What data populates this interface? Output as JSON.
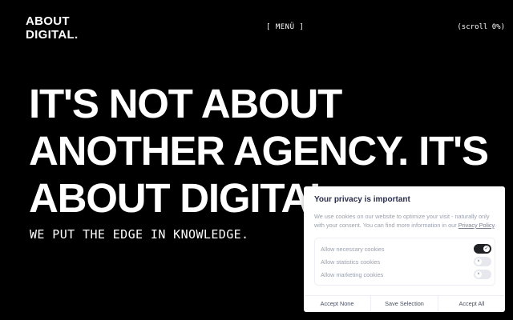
{
  "header": {
    "logo_line1": "ABOUT",
    "logo_line2": "DIGITAL.",
    "menu_label": "[ MENÜ ]",
    "scroll_label": "(scroll 0%)"
  },
  "hero": {
    "line1": "IT'S NOT ABOUT",
    "line2": "ANOTHER AGENCY. IT'S",
    "line3": "ABOUT DIGITAL.",
    "tagline": "WE PUT THE EDGE IN KNOWLEDGE."
  },
  "cookie_banner": {
    "title": "Your privacy is important",
    "description": "We use cookies on our website to optimize your visit - naturally only with your consent. You can find more information in our",
    "policy_link": "Privacy Policy",
    "options": [
      {
        "label": "Allow necessary cookies",
        "enabled": true
      },
      {
        "label": "Allow statistics cookies",
        "enabled": false
      },
      {
        "label": "Allow marketing cookies",
        "enabled": false
      }
    ],
    "buttons": {
      "accept_none": "Accept None",
      "save_selection": "Save Selection",
      "accept_all": "Accept All"
    }
  },
  "colors": {
    "background": "#000000",
    "text": "#ffffff",
    "toggle_on": "#1f2124"
  }
}
